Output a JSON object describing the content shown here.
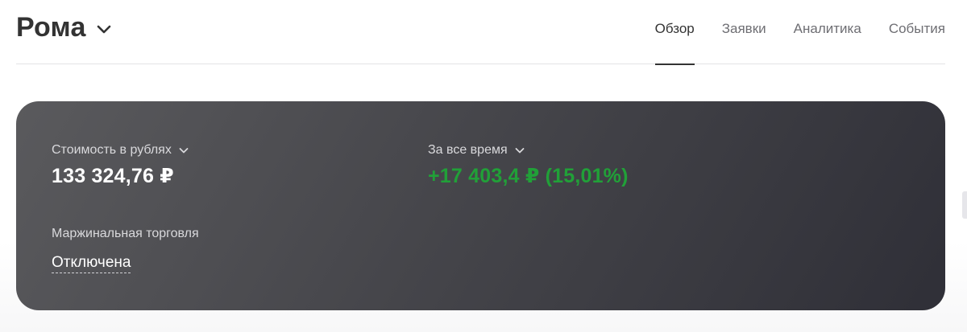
{
  "header": {
    "account_name": "Рома",
    "tabs": [
      {
        "label": "Обзор",
        "active": true
      },
      {
        "label": "Заявки",
        "active": false
      },
      {
        "label": "Аналитика",
        "active": false
      },
      {
        "label": "События",
        "active": false
      }
    ]
  },
  "summary": {
    "value_label": "Стоимость в рублях",
    "value": "133 324,76 ₽",
    "period_label": "За все время",
    "change": "+17 403,4 ₽ (15,01%)",
    "margin_label": "Маржинальная торговля",
    "margin_status": "Отключена"
  },
  "colors": {
    "card_start": "#5a5a5d",
    "card_end": "#2f2f37",
    "positive": "#21a038",
    "text_dark": "#333333",
    "text_muted": "#6e6e73"
  },
  "icons": {
    "account_dropdown": "chevron-down-icon",
    "value_dropdown": "chevron-down-icon",
    "period_dropdown": "chevron-down-icon"
  }
}
